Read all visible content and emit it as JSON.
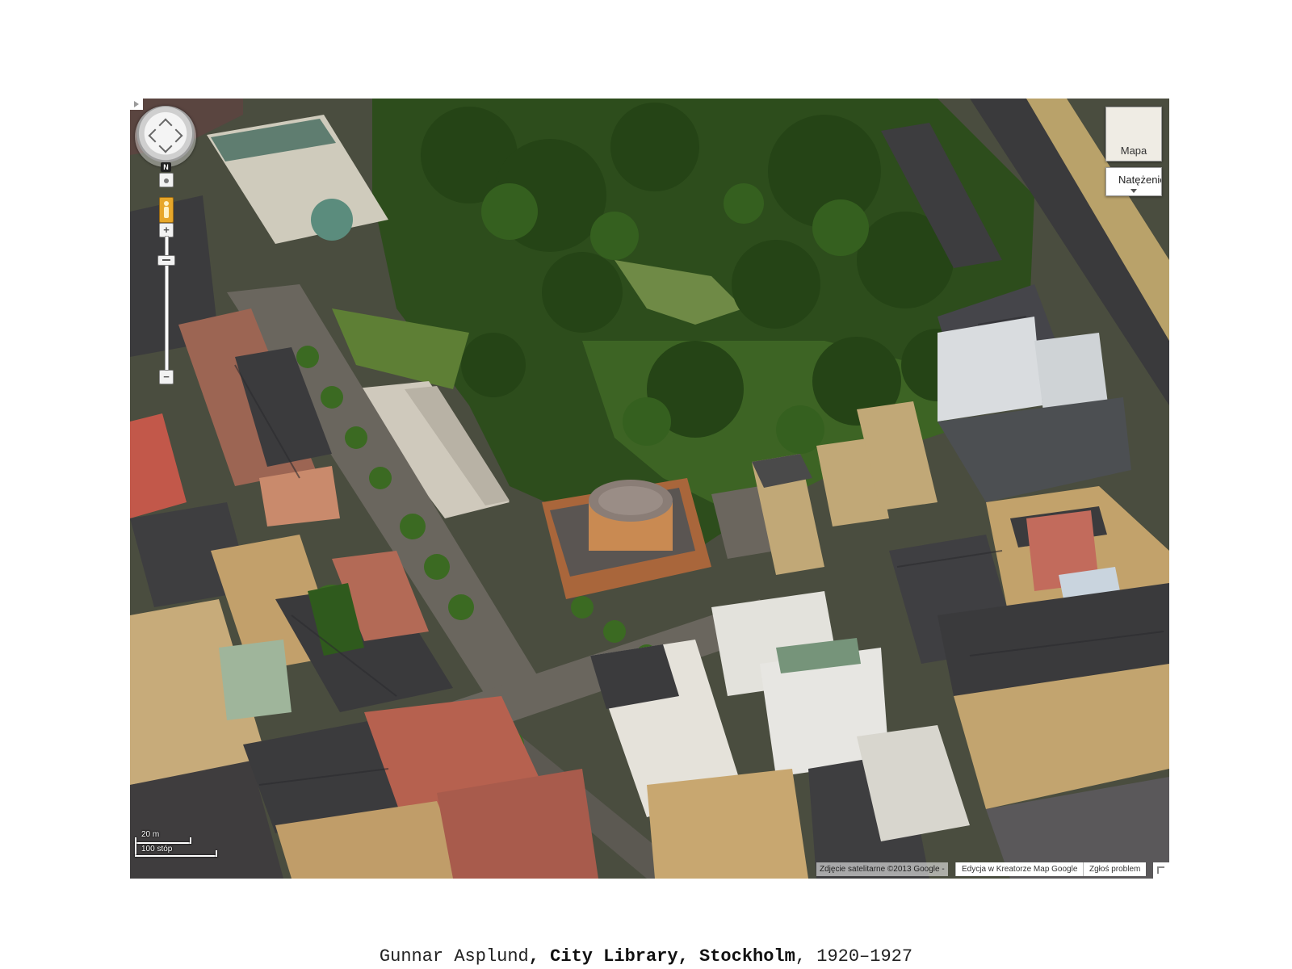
{
  "map": {
    "view_type": "aerial satellite 45-degree view",
    "controls": {
      "north_label": "N",
      "zoom_in_label": "+",
      "zoom_out_label": "−",
      "map_type_label": "Mapa",
      "layer_label": "Natężenie"
    },
    "scale": {
      "metric": "20 m",
      "imperial": "100 stóp"
    },
    "attribution": {
      "copyright": "Zdjęcie satelitarne ©2013 Google -",
      "edit_link": "Edycja w Kreatorze Map Google",
      "report_link": "Zgłoś problem"
    },
    "colors": {
      "trees": "#2f5a1d",
      "grass": "#6b8a3a",
      "library_rotunda": "#c98a52",
      "library_roof": "#8a7d76"
    }
  },
  "caption": {
    "architect": "Gunnar Asplund",
    "separator_1": ", ",
    "building": "City Library",
    "separator_2": ", ",
    "city": "Stockholm",
    "separator_3": ", ",
    "years": "1920–1927"
  }
}
